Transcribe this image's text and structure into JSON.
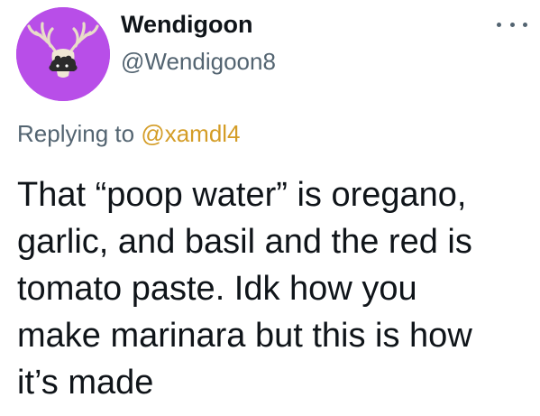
{
  "tweet": {
    "author": {
      "display_name": "Wendigoon",
      "handle": "@Wendigoon8",
      "avatar_icon": "deer-skull-avatar-icon",
      "avatar_bg": "#b84ee8"
    },
    "more_icon": "more-options-icon",
    "reply_context": {
      "prefix": "Replying to",
      "mention": "@xamdl4",
      "mention_color": "#d49d27"
    },
    "text_lines": [
      "That “poop water” is oregano,",
      "garlic, and basil and the red is",
      "tomato paste. Idk how you",
      "make marinara but this is how",
      "it’s made"
    ]
  }
}
